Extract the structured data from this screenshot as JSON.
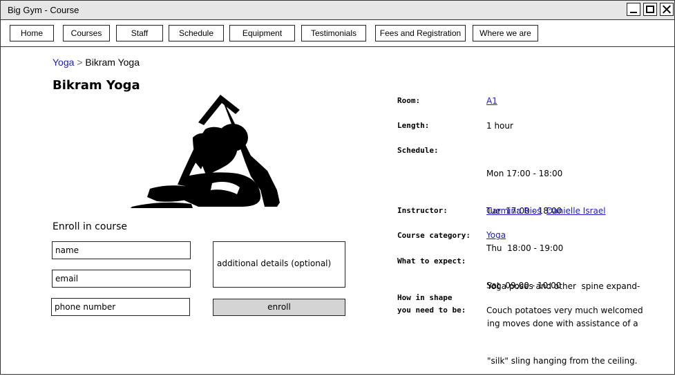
{
  "window": {
    "title": "Big Gym - Course"
  },
  "nav": {
    "items": [
      "Home",
      "Courses",
      "Staff",
      "Schedule",
      "Equipment",
      "Testimonials",
      "Fees and Registration",
      "Where we are"
    ]
  },
  "breadcrumb": {
    "parent": "Yoga",
    "separator": ">",
    "current": "Bikram Yoga"
  },
  "course": {
    "title": "Bikram Yoga"
  },
  "enroll": {
    "heading": "Enroll in course",
    "name_placeholder": "name",
    "email_placeholder": "email",
    "phone_placeholder": "phone number",
    "details_placeholder": "additional details (optional)",
    "button": "enroll"
  },
  "details": {
    "room_label": "Room:",
    "room_value": "A1",
    "length_label": "Length:",
    "length_value": "1 hour",
    "schedule_label": "Schedule:",
    "schedule": [
      "Mon 17:00 - 18:00",
      "Tue  17:00 - 18:00",
      "Thu  18:00 - 19:00",
      "Sat  09:00 - 10:00"
    ],
    "instructor_label": "Instructor:",
    "instructors": [
      "Carmina Rios",
      "Danielle Israel"
    ],
    "category_label": "Course category:",
    "category_value": "Yoga",
    "expect_label": "What to expect:",
    "expect_lines": [
      "Yoga poses and other  spine expand-",
      "ing moves done with assistance of a",
      "\"silk\" sling hanging from the ceiling."
    ],
    "shape_label_1": "How in shape",
    "shape_label_2": "you need to be:",
    "shape_value": "Couch potatoes very much welcomed"
  }
}
